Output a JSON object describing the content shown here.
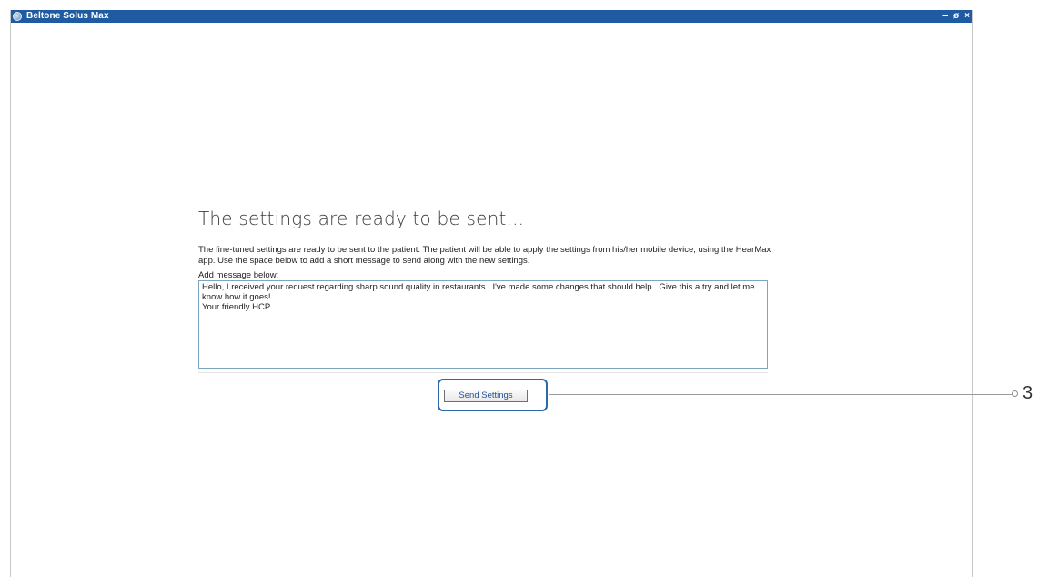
{
  "window": {
    "title": "Beltone Solus Max",
    "controls": {
      "minimize": "‒",
      "restore": "ø",
      "close": "×"
    }
  },
  "main": {
    "heading": "The settings are ready to be sent...",
    "description": "The fine-tuned settings are ready to be sent to the patient. The patient will be able to apply the settings from his/her mobile device, using the HearMax app.  Use the space below to add a short message to send along with the new settings.",
    "message_label": "Add message below:",
    "message_value": "Hello, I received your request regarding sharp sound quality in restaurants.  I've made some changes that should help.  Give this a try and let me know how it goes!\nYour friendly HCP",
    "send_button_label": "Send Settings"
  },
  "callout": {
    "number": "3"
  },
  "colors": {
    "titlebar": "#1e5ba3",
    "highlight": "#2b6aa7",
    "button_text": "#1f4e96"
  }
}
